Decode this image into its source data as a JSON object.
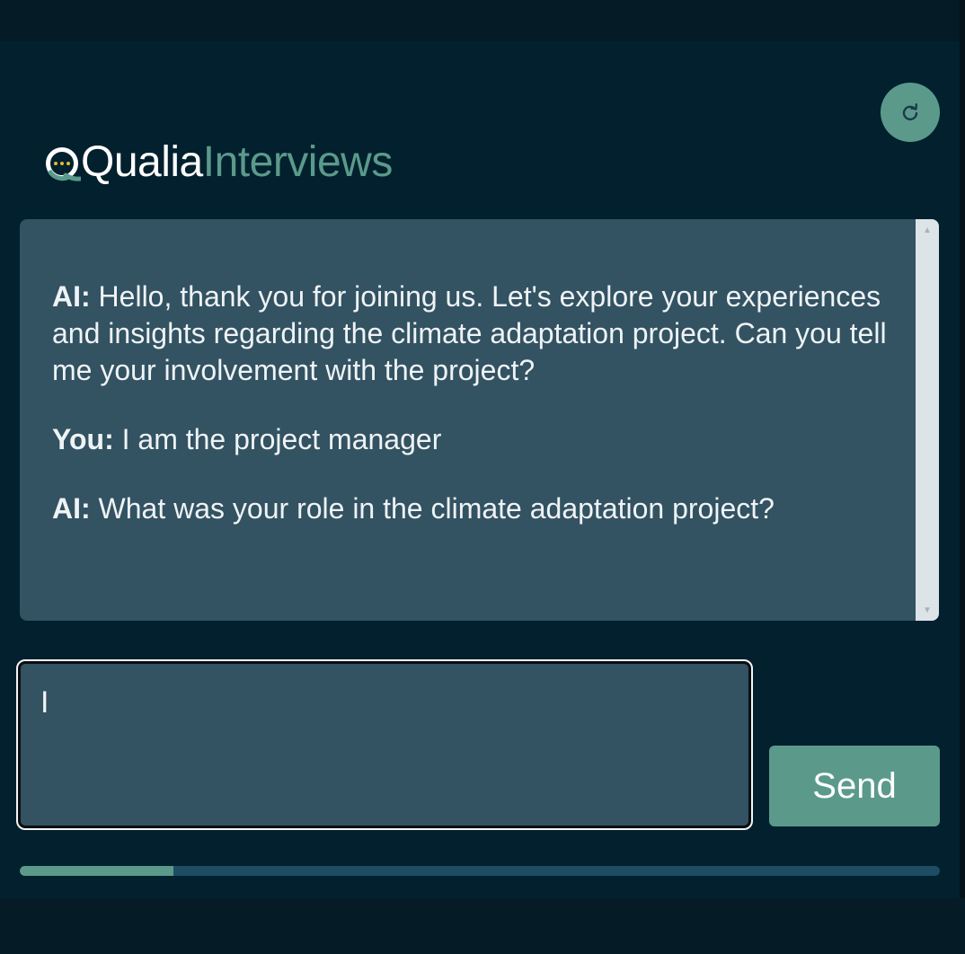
{
  "logo": {
    "word_1": "Qualia",
    "word_2": "Interviews"
  },
  "refresh_button": {
    "icon": "refresh-icon"
  },
  "chat": {
    "messages": [
      {
        "speaker": "AI:",
        "text": "Hello, thank you for joining us. Let's explore your experiences and insights regarding the climate adaptation project. Can you tell me your involvement with the project?"
      },
      {
        "speaker": "You:",
        "text": "I am the project manager"
      },
      {
        "speaker": "AI:",
        "text": "What was your role in the climate adaptation project?"
      }
    ]
  },
  "input": {
    "value": "I"
  },
  "send_button": {
    "label": "Send"
  },
  "progress": {
    "fraction": 0.167
  },
  "colors": {
    "accent": "#5b9a8b",
    "background": "#02202e",
    "panel": "#335262"
  }
}
